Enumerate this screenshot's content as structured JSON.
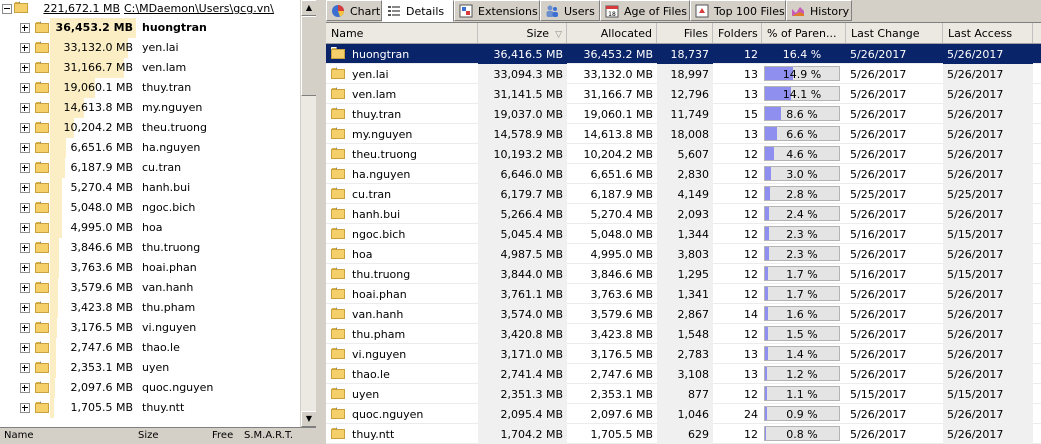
{
  "left_tree": {
    "root": {
      "size": "221,672.1 MB",
      "path": "C:\\MDaemon\\Users\\gcg.vn\\"
    },
    "items": [
      {
        "size": "36,453.2 MB",
        "name": "huongtran"
      },
      {
        "size": "33,132.0 MB",
        "name": "yen.lai"
      },
      {
        "size": "31,166.7 MB",
        "name": "ven.lam"
      },
      {
        "size": "19,060.1 MB",
        "name": "thuy.tran"
      },
      {
        "size": "14,613.8 MB",
        "name": "my.nguyen"
      },
      {
        "size": "10,204.2 MB",
        "name": "theu.truong"
      },
      {
        "size": "6,651.6 MB",
        "name": "ha.nguyen"
      },
      {
        "size": "6,187.9 MB",
        "name": "cu.tran"
      },
      {
        "size": "5,270.4 MB",
        "name": "hanh.bui"
      },
      {
        "size": "5,048.0 MB",
        "name": "ngoc.bich"
      },
      {
        "size": "4,995.0 MB",
        "name": "hoa"
      },
      {
        "size": "3,846.6 MB",
        "name": "thu.truong"
      },
      {
        "size": "3,763.6 MB",
        "name": "hoai.phan"
      },
      {
        "size": "3,579.6 MB",
        "name": "van.hanh"
      },
      {
        "size": "3,423.8 MB",
        "name": "thu.pham"
      },
      {
        "size": "3,176.5 MB",
        "name": "vi.nguyen"
      },
      {
        "size": "2,747.6 MB",
        "name": "thao.le"
      },
      {
        "size": "2,353.1 MB",
        "name": "uyen"
      },
      {
        "size": "2,097.6 MB",
        "name": "quoc.nguyen"
      },
      {
        "size": "1,705.5 MB",
        "name": "thuy.ntt"
      }
    ],
    "footer": {
      "name": "Name",
      "size": "Size",
      "free": "Free",
      "smart": "S.M.A.R.T."
    }
  },
  "tabs": [
    {
      "label": "Chart",
      "icon": "pie-chart-icon"
    },
    {
      "label": "Details",
      "icon": "details-list-icon"
    },
    {
      "label": "Extensions",
      "icon": "extensions-icon"
    },
    {
      "label": "Users",
      "icon": "users-icon"
    },
    {
      "label": "Age of Files",
      "icon": "calendar-icon"
    },
    {
      "label": "Top 100 Files",
      "icon": "top100-icon"
    },
    {
      "label": "History",
      "icon": "history-chart-icon"
    }
  ],
  "active_tab": "Details",
  "columns": {
    "name": "Name",
    "size": "Size",
    "size_sort": "▽",
    "allocated": "Allocated",
    "files": "Files",
    "folders": "Folders",
    "pct": "% of Paren...",
    "last_change": "Last Change",
    "last_access": "Last Access"
  },
  "rows": [
    {
      "name": "huongtran",
      "size": "36,416.5 MB",
      "allocated": "36,453.2 MB",
      "files": "18,737",
      "folders": "12",
      "pct": "16.4 %",
      "pct_value": 0.164,
      "last_change": "5/26/2017",
      "last_access": "5/26/2017"
    },
    {
      "name": "yen.lai",
      "size": "33,094.3 MB",
      "allocated": "33,132.0 MB",
      "files": "18,997",
      "folders": "13",
      "pct": "14.9 %",
      "pct_value": 0.149,
      "last_change": "5/26/2017",
      "last_access": "5/26/2017"
    },
    {
      "name": "ven.lam",
      "size": "31,141.5 MB",
      "allocated": "31,166.7 MB",
      "files": "12,796",
      "folders": "13",
      "pct": "14.1 %",
      "pct_value": 0.141,
      "last_change": "5/26/2017",
      "last_access": "5/26/2017"
    },
    {
      "name": "thuy.tran",
      "size": "19,037.0 MB",
      "allocated": "19,060.1 MB",
      "files": "11,749",
      "folders": "15",
      "pct": "8.6 %",
      "pct_value": 0.086,
      "last_change": "5/26/2017",
      "last_access": "5/26/2017"
    },
    {
      "name": "my.nguyen",
      "size": "14,578.9 MB",
      "allocated": "14,613.8 MB",
      "files": "18,008",
      "folders": "13",
      "pct": "6.6 %",
      "pct_value": 0.066,
      "last_change": "5/26/2017",
      "last_access": "5/26/2017"
    },
    {
      "name": "theu.truong",
      "size": "10,193.2 MB",
      "allocated": "10,204.2 MB",
      "files": "5,607",
      "folders": "12",
      "pct": "4.6 %",
      "pct_value": 0.046,
      "last_change": "5/26/2017",
      "last_access": "5/26/2017"
    },
    {
      "name": "ha.nguyen",
      "size": "6,646.0 MB",
      "allocated": "6,651.6 MB",
      "files": "2,830",
      "folders": "12",
      "pct": "3.0 %",
      "pct_value": 0.03,
      "last_change": "5/26/2017",
      "last_access": "5/26/2017"
    },
    {
      "name": "cu.tran",
      "size": "6,179.7 MB",
      "allocated": "6,187.9 MB",
      "files": "4,149",
      "folders": "12",
      "pct": "2.8 %",
      "pct_value": 0.028,
      "last_change": "5/25/2017",
      "last_access": "5/25/2017"
    },
    {
      "name": "hanh.bui",
      "size": "5,266.4 MB",
      "allocated": "5,270.4 MB",
      "files": "2,093",
      "folders": "12",
      "pct": "2.4 %",
      "pct_value": 0.024,
      "last_change": "5/26/2017",
      "last_access": "5/26/2017"
    },
    {
      "name": "ngoc.bich",
      "size": "5,045.4 MB",
      "allocated": "5,048.0 MB",
      "files": "1,344",
      "folders": "12",
      "pct": "2.3 %",
      "pct_value": 0.023,
      "last_change": "5/16/2017",
      "last_access": "5/15/2017"
    },
    {
      "name": "hoa",
      "size": "4,987.5 MB",
      "allocated": "4,995.0 MB",
      "files": "3,803",
      "folders": "12",
      "pct": "2.3 %",
      "pct_value": 0.023,
      "last_change": "5/26/2017",
      "last_access": "5/26/2017"
    },
    {
      "name": "thu.truong",
      "size": "3,844.0 MB",
      "allocated": "3,846.6 MB",
      "files": "1,295",
      "folders": "12",
      "pct": "1.7 %",
      "pct_value": 0.017,
      "last_change": "5/16/2017",
      "last_access": "5/15/2017"
    },
    {
      "name": "hoai.phan",
      "size": "3,761.1 MB",
      "allocated": "3,763.6 MB",
      "files": "1,341",
      "folders": "12",
      "pct": "1.7 %",
      "pct_value": 0.017,
      "last_change": "5/26/2017",
      "last_access": "5/26/2017"
    },
    {
      "name": "van.hanh",
      "size": "3,574.0 MB",
      "allocated": "3,579.6 MB",
      "files": "2,867",
      "folders": "14",
      "pct": "1.6 %",
      "pct_value": 0.016,
      "last_change": "5/26/2017",
      "last_access": "5/26/2017"
    },
    {
      "name": "thu.pham",
      "size": "3,420.8 MB",
      "allocated": "3,423.8 MB",
      "files": "1,548",
      "folders": "12",
      "pct": "1.5 %",
      "pct_value": 0.015,
      "last_change": "5/26/2017",
      "last_access": "5/26/2017"
    },
    {
      "name": "vi.nguyen",
      "size": "3,171.0 MB",
      "allocated": "3,176.5 MB",
      "files": "2,783",
      "folders": "13",
      "pct": "1.4 %",
      "pct_value": 0.014,
      "last_change": "5/26/2017",
      "last_access": "5/26/2017"
    },
    {
      "name": "thao.le",
      "size": "2,741.4 MB",
      "allocated": "2,747.6 MB",
      "files": "3,108",
      "folders": "13",
      "pct": "1.2 %",
      "pct_value": 0.012,
      "last_change": "5/26/2017",
      "last_access": "5/26/2017"
    },
    {
      "name": "uyen",
      "size": "2,351.3 MB",
      "allocated": "2,353.1 MB",
      "files": "877",
      "folders": "12",
      "pct": "1.1 %",
      "pct_value": 0.011,
      "last_change": "5/15/2017",
      "last_access": "5/15/2017"
    },
    {
      "name": "quoc.nguyen",
      "size": "2,095.4 MB",
      "allocated": "2,097.6 MB",
      "files": "1,046",
      "folders": "24",
      "pct": "0.9 %",
      "pct_value": 0.009,
      "last_change": "5/26/2017",
      "last_access": "5/26/2017"
    },
    {
      "name": "thuy.ntt",
      "size": "1,704.2 MB",
      "allocated": "1,705.5 MB",
      "files": "629",
      "folders": "12",
      "pct": "0.8 %",
      "pct_value": 0.008,
      "last_change": "5/26/2017",
      "last_access": "5/26/2017"
    }
  ],
  "colors": {
    "selection": "#0a246a",
    "pct_bar": "#8f8fef",
    "size_bar": "#fbeec5"
  }
}
